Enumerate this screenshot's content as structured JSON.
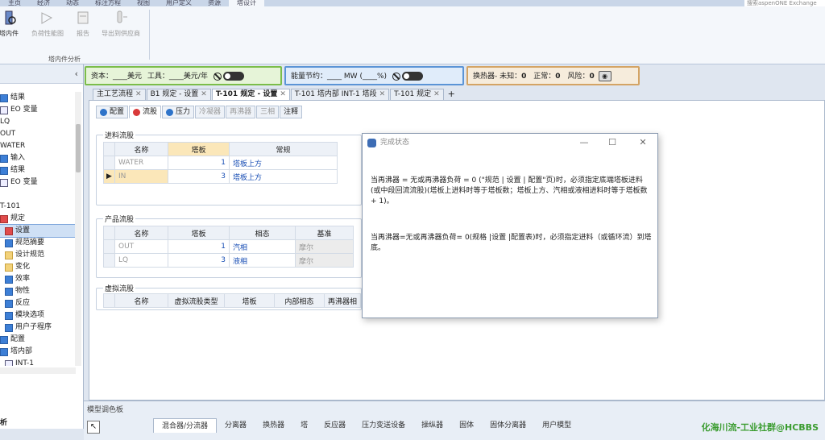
{
  "ribbon_tabs": [
    "主页",
    "经济",
    "动态",
    "标注方程",
    "视图",
    "用户定义",
    "资源",
    "塔设计"
  ],
  "ribbon_active_tab": "塔设计",
  "search_placeholder": "搜索aspenONE Exchange",
  "ribbon_buttons": [
    {
      "label": "塔内件",
      "icon": "tower-internals-icon",
      "enabled": true
    },
    {
      "label": "负荷性能图",
      "icon": "hydraulic-plot-icon",
      "enabled": false
    },
    {
      "label": "报告",
      "icon": "report-icon",
      "enabled": false
    },
    {
      "label": "导出到供应商",
      "icon": "export-vendor-icon",
      "enabled": false
    }
  ],
  "ribbon_group_label": "塔内件分析",
  "sidebar": {
    "tree": [
      {
        "label": "结果",
        "icon": "check",
        "indent": 0
      },
      {
        "label": "EO 变量",
        "icon": "plain",
        "indent": 0
      },
      {
        "label": "LQ",
        "icon": "none",
        "indent": 0
      },
      {
        "label": "OUT",
        "icon": "none",
        "indent": 0
      },
      {
        "label": "WATER",
        "icon": "none",
        "indent": 0
      },
      {
        "label": "输入",
        "icon": "check",
        "indent": 0
      },
      {
        "label": "结果",
        "icon": "check",
        "indent": 0
      },
      {
        "label": "EO 变量",
        "icon": "plain",
        "indent": 0
      },
      {
        "label": "",
        "icon": "none",
        "indent": 0
      },
      {
        "label": "T-101",
        "icon": "none",
        "indent": 0
      },
      {
        "label": "规定",
        "icon": "red",
        "indent": 0
      },
      {
        "label": "设置",
        "icon": "red",
        "indent": 1,
        "selected": true
      },
      {
        "label": "规范摘要",
        "icon": "check",
        "indent": 1
      },
      {
        "label": "设计规范",
        "icon": "folder",
        "indent": 1
      },
      {
        "label": "变化",
        "icon": "folder",
        "indent": 1
      },
      {
        "label": "效率",
        "icon": "check",
        "indent": 1
      },
      {
        "label": "物性",
        "icon": "check",
        "indent": 1
      },
      {
        "label": "反应",
        "icon": "check",
        "indent": 1
      },
      {
        "label": "模块选项",
        "icon": "check",
        "indent": 1
      },
      {
        "label": "用户子程序",
        "icon": "check",
        "indent": 1
      },
      {
        "label": "配置",
        "icon": "check",
        "indent": 0
      },
      {
        "label": "塔内部",
        "icon": "check",
        "indent": 0
      },
      {
        "label": "INT-1",
        "icon": "plain",
        "indent": 1
      }
    ],
    "bottom_label": "析"
  },
  "status": {
    "cost_label": "资本：",
    "cost_blank1": "____",
    "cost_unit1": "美元",
    "tools_label": "工具：",
    "cost_blank2": "____",
    "cost_unit2": "美元/年",
    "energy_label": "能量节约：",
    "energy_blank": "____",
    "energy_unit": "MW",
    "energy_pct": "(____%)",
    "hx_label": "换热器-",
    "hx_unknown_label": "未知：",
    "hx_unknown": "0",
    "hx_normal_label": "正常：",
    "hx_normal": "0",
    "hx_risk_label": "风险：",
    "hx_risk": "0"
  },
  "doc_tabs": [
    {
      "label": "主工艺流程",
      "active": false
    },
    {
      "label": "B1 规定 - 设置",
      "active": false
    },
    {
      "label": "T-101 规定 - 设置",
      "active": true
    },
    {
      "label": "T-101 塔内部 INT-1 塔段",
      "active": false
    },
    {
      "label": "T-101 规定",
      "active": false
    }
  ],
  "doc_plus": "+",
  "sub_tabs": [
    {
      "label": "配置",
      "state": "done",
      "dot": "blue"
    },
    {
      "label": "流股",
      "state": "active",
      "dot": "red"
    },
    {
      "label": "压力",
      "state": "done",
      "dot": "blue"
    },
    {
      "label": "冷凝器",
      "state": "disabled",
      "dot": ""
    },
    {
      "label": "再沸器",
      "state": "disabled",
      "dot": ""
    },
    {
      "label": "三相",
      "state": "disabled",
      "dot": ""
    },
    {
      "label": "注释",
      "state": "done",
      "dot": ""
    }
  ],
  "feed": {
    "title": "进料流股",
    "headers": [
      "名称",
      "塔板",
      "常规"
    ],
    "rows": [
      {
        "name": "WATER",
        "stage": "1",
        "conv": "塔板上方",
        "selected": false
      },
      {
        "name": "IN",
        "stage": "3",
        "conv": "塔板上方",
        "selected": true
      }
    ]
  },
  "product": {
    "title": "产品流股",
    "headers": [
      "名称",
      "塔板",
      "相态",
      "基准"
    ],
    "rows": [
      {
        "name": "OUT",
        "stage": "1",
        "phase": "汽相",
        "basis": "摩尔"
      },
      {
        "name": "LQ",
        "stage": "3",
        "phase": "液相",
        "basis": "摩尔"
      }
    ]
  },
  "pseudo": {
    "title": "虚拟流股",
    "headers": [
      "名称",
      "虚拟流股类型",
      "塔板",
      "内部相态",
      "再沸器相"
    ]
  },
  "dialog": {
    "title": "完成状态",
    "min": "—",
    "max": "☐",
    "close": "✕",
    "para1": "当再沸器 = 无或再沸器负荷 = 0 (\"规范 | 设置 | 配置\"页)时，必须指定底端塔板进料(或中段回流流股)(塔板上进料时等于塔板数；塔板上方、汽相或液相进料时等于塔板数 + 1)。",
    "para2": "当再沸器=无或再沸器负荷= 0(规格 |设置 |配置表)时，必须指定进料（或循环流）到塔底。"
  },
  "palette": {
    "title": "模型调色板",
    "tabs": [
      "混合器/分流器",
      "分离器",
      "换热器",
      "塔",
      "反应器",
      "压力变送设备",
      "操纵器",
      "固体",
      "固体分离器",
      "用户模型"
    ],
    "active": "混合器/分流器"
  },
  "watermark": "化海川流-工业社群@HCBBS"
}
